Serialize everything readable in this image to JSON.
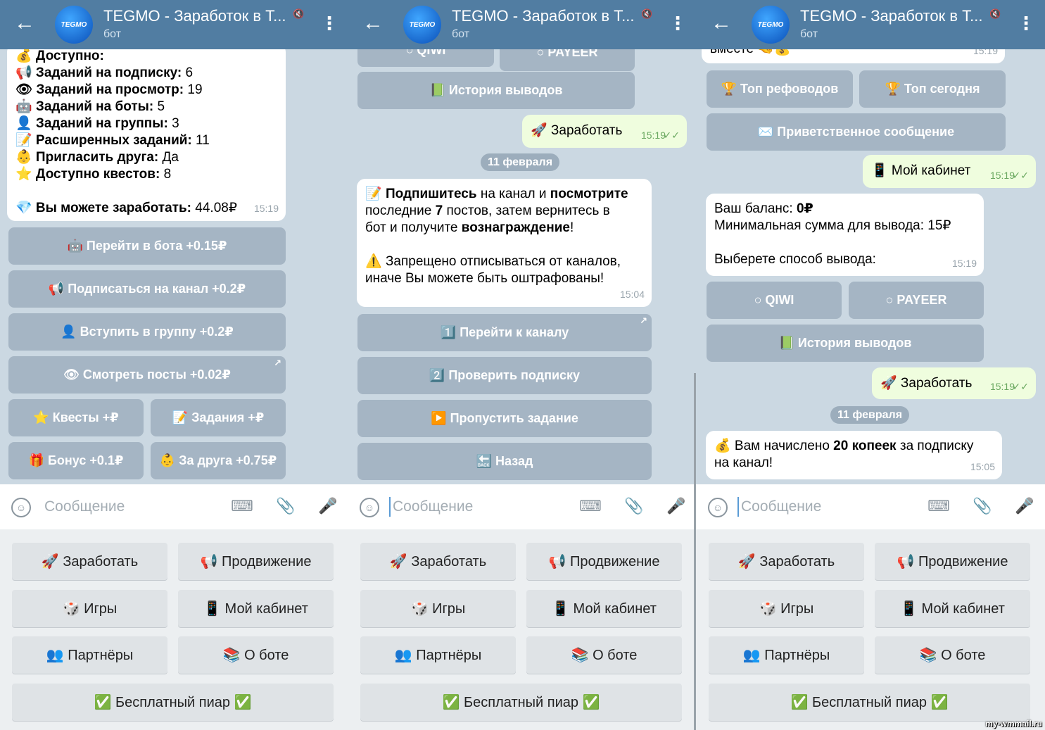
{
  "header": {
    "title": "TEGMO - Заработок в Т...",
    "subtitle": "бот",
    "avatar_text": "TEGMO",
    "back_icon": "arrow-left-icon",
    "mute_icon": "muted-icon",
    "menu_icon": "more-vert-icon"
  },
  "input": {
    "placeholder": "Сообщение"
  },
  "keyboard": [
    {
      "label": "🚀 Заработать"
    },
    {
      "label": "📢 Продвижение"
    },
    {
      "label": "🎲 Игры"
    },
    {
      "label": "📱 Мой кабинет"
    },
    {
      "label": "👥 Партнёры"
    },
    {
      "label": "📚 О боте"
    },
    {
      "label": "✅ Бесплатный пиар ✅"
    }
  ],
  "panels": [
    {
      "messages": [
        {
          "type": "in",
          "lines": [
            [
              {
                "t": "💰 Доступно:",
                "b": true
              }
            ],
            [
              {
                "t": "📢 Заданий на подписку:",
                "b": true
              },
              {
                "t": " 6"
              }
            ],
            [
              {
                "t": "👁 Заданий на просмотр:",
                "b": true
              },
              {
                "t": " 19"
              }
            ],
            [
              {
                "t": "🤖 Заданий на боты:",
                "b": true
              },
              {
                "t": " 5"
              }
            ],
            [
              {
                "t": "👤 Заданий на группы:",
                "b": true
              },
              {
                "t": " 3"
              }
            ],
            [
              {
                "t": "📝 Расширенных заданий:",
                "b": true
              },
              {
                "t": " 11"
              }
            ],
            [
              {
                "t": "👶 Пригласить друга:",
                "b": true
              },
              {
                "t": " Да"
              }
            ],
            [
              {
                "t": "⭐ Доступно квестов:",
                "b": true
              },
              {
                "t": " 8"
              }
            ],
            [],
            [
              {
                "t": "💎 Вы можете заработать:",
                "b": true
              },
              {
                "t": " 44.08₽"
              }
            ]
          ],
          "time": "15:19"
        }
      ],
      "buttons": [
        {
          "label": "🤖 Перейти в бота +0.15₽"
        },
        {
          "label": "📢 Подписаться на канал +0.2₽"
        },
        {
          "label": "👤 Вступить в группу +0.2₽"
        },
        {
          "label": "👁 Смотреть посты +0.02₽",
          "link": true
        },
        {
          "label": "⭐ Квесты +₽"
        },
        {
          "label": "📝 Задания +₽"
        },
        {
          "label": "🎁 Бонус +0.1₽"
        },
        {
          "label": "👶 За друга +0.75₽"
        }
      ]
    },
    {
      "messages": [
        {
          "type": "out",
          "lines": [
            [
              {
                "t": "🚀 Заработать"
              }
            ]
          ],
          "time": "15:19"
        },
        {
          "type": "date",
          "text": "11 февраля"
        },
        {
          "type": "in",
          "lines": [
            [
              {
                "t": "📝 "
              },
              {
                "t": "Подпишитесь",
                "b": true
              },
              {
                "t": " на канал и "
              },
              {
                "t": "посмотрите",
                "b": true
              }
            ],
            [
              {
                "t": "последние "
              },
              {
                "t": "7",
                "b": true
              },
              {
                "t": " постов, затем вернитесь в"
              }
            ],
            [
              {
                "t": "бот и получите "
              },
              {
                "t": "вознаграждение",
                "b": true
              },
              {
                "t": "!"
              }
            ],
            [],
            [
              {
                "t": "⚠️ Запрещено отписываться от каналов,"
              }
            ],
            [
              {
                "t": "иначе Вы можете быть оштрафованы!"
              }
            ]
          ],
          "time": "15:04"
        }
      ],
      "buttons": [
        {
          "label": "○ QIWI"
        },
        {
          "label": "○ PAYEER"
        },
        {
          "label": "📗 История выводов"
        },
        {
          "label": "1️⃣ Перейти к каналу",
          "link": true
        },
        {
          "label": "2️⃣ Проверить подписку"
        },
        {
          "label": "▶️ Пропустить задание"
        },
        {
          "label": "🔙 Назад"
        }
      ]
    },
    {
      "messages": [
        {
          "type": "in",
          "lines": [
            [
              {
                "t": "вместе 🤜💰"
              }
            ]
          ],
          "time": "15:19"
        },
        {
          "type": "out",
          "lines": [
            [
              {
                "t": "📱 Мой кабинет"
              }
            ]
          ],
          "time": "15:19"
        },
        {
          "type": "in",
          "lines": [
            [
              {
                "t": "Ваш баланс: "
              },
              {
                "t": "0₽",
                "b": true
              }
            ],
            [
              {
                "t": "Минимальная сумма для вывода: 15₽"
              }
            ],
            [],
            [
              {
                "t": "Выберете способ вывода:"
              }
            ]
          ],
          "time": "15:19"
        },
        {
          "type": "out",
          "lines": [
            [
              {
                "t": "🚀 Заработать"
              }
            ]
          ],
          "time": "15:19"
        },
        {
          "type": "date",
          "text": "11 февраля"
        },
        {
          "type": "in",
          "lines": [
            [
              {
                "t": "💰 Вам начислено "
              },
              {
                "t": "20 копеек",
                "b": true
              },
              {
                "t": " за подписку"
              }
            ],
            [
              {
                "t": "на канал!"
              }
            ]
          ],
          "time": "15:05"
        }
      ],
      "buttons": [
        {
          "label": "🏆 Топ рефоводов"
        },
        {
          "label": "🏆 Топ сегодня"
        },
        {
          "label": "✉️ Приветственное сообщение"
        },
        {
          "label": "○ QIWI"
        },
        {
          "label": "○ PAYEER"
        },
        {
          "label": "📗 История выводов"
        }
      ]
    }
  ],
  "watermark": "my-wmmail.ru",
  "colors": {
    "header": "#517da2",
    "chat_bg": "#cbd8e2",
    "outgoing": "#effdde",
    "keyboard_bg": "#eceff1"
  }
}
